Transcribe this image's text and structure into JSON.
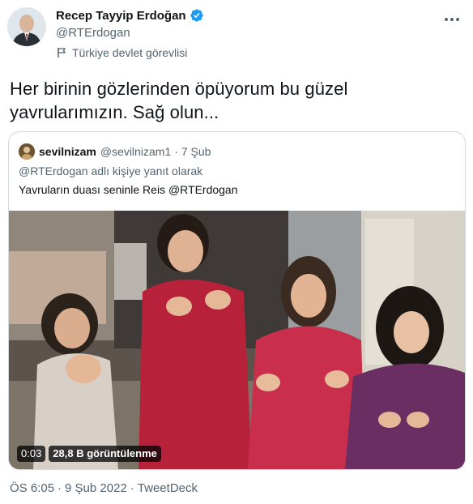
{
  "author": {
    "name": "Recep Tayyip Erdoğan",
    "handle": "@RTErdogan",
    "label": "Türkiye devlet görevlisi"
  },
  "tweet": {
    "text_line1": "Her birinin gözlerinden öpüyorum bu güzel",
    "text_line2": "yavrularımızın. Sağ olun..."
  },
  "quoted": {
    "name": "sevilnizam",
    "handle": "@sevilnizam1",
    "dot": "·",
    "time": "7 Şub",
    "reply_context": "@RTErdogan adlı kişiye yanıt olarak",
    "text": "Yavruların duası seninle Reis @RTErdogan",
    "video": {
      "duration": "0:03",
      "views": "28,8 B görüntülenme"
    }
  },
  "meta": {
    "time": "ÖS 6:05",
    "dot1": "·",
    "date": "9 Şub 2022",
    "dot2": "·",
    "source": "TweetDeck"
  },
  "colors": {
    "verified": "#1d9bf0",
    "secondary_text": "#536471",
    "primary_text": "#0f1419",
    "border": "#cfd9de"
  },
  "icons": {
    "verified": "verified-badge-icon",
    "gov_label": "flag-icon",
    "more": "more-options-icon"
  }
}
